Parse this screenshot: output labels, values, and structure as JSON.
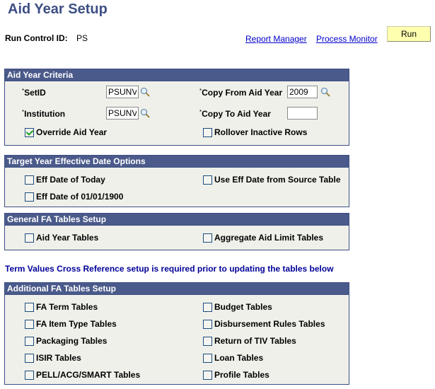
{
  "header": {
    "title": "Aid Year Setup",
    "run_control_label": "Run Control ID:",
    "run_control_value": "PS",
    "links": [
      "Report Manager",
      "Process Monitor"
    ],
    "run_button": "Run"
  },
  "aid_year_criteria": {
    "title": "Aid Year Criteria",
    "required_marker": "*",
    "setid_label": "SetID",
    "setid_value": "PSUNV",
    "institution_label": "Institution",
    "institution_value": "PSUNV",
    "copy_from_label": "Copy From Aid Year",
    "copy_from_value": "2009",
    "copy_to_label": "Copy To Aid Year",
    "copy_to_value": "",
    "override_label": "Override Aid Year",
    "override_checked": true,
    "rollover_label": "Rollover Inactive Rows",
    "rollover_checked": false
  },
  "target_year": {
    "title": "Target Year Effective Date Options",
    "options": [
      {
        "label": "Eff Date of Today",
        "checked": false
      },
      {
        "label": "Use Eff Date from Source Table",
        "checked": false
      },
      {
        "label": "Eff Date of 01/01/1900",
        "checked": false
      }
    ]
  },
  "general_fa": {
    "title": "General FA Tables Setup",
    "options": [
      {
        "label": "Aid Year Tables",
        "checked": false
      },
      {
        "label": "Aggregate Aid Limit Tables",
        "checked": false
      }
    ]
  },
  "notice": "Term Values Cross Reference setup is required prior to updating the tables below",
  "additional_fa": {
    "title": "Additional FA Tables Setup",
    "left": [
      {
        "label": "FA Term Tables",
        "checked": false
      },
      {
        "label": "FA Item Type Tables",
        "checked": false
      },
      {
        "label": "Packaging Tables",
        "checked": false
      },
      {
        "label": "ISIR Tables",
        "checked": false
      },
      {
        "label": "PELL/ACG/SMART Tables",
        "checked": false
      }
    ],
    "right": [
      {
        "label": "Budget Tables",
        "checked": false
      },
      {
        "label": "Disbursement Rules Tables",
        "checked": false
      },
      {
        "label": "Return of TIV Tables",
        "checked": false
      },
      {
        "label": "Loan Tables",
        "checked": false
      },
      {
        "label": "Profile Tables",
        "checked": false
      }
    ]
  },
  "colors": {
    "title": "#3d4f84",
    "panel_header": "#4a5a8a",
    "panel_body": "#f0f0ea",
    "link": "#0000cc",
    "notice": "#000099",
    "run_button": "#ffffb0"
  }
}
